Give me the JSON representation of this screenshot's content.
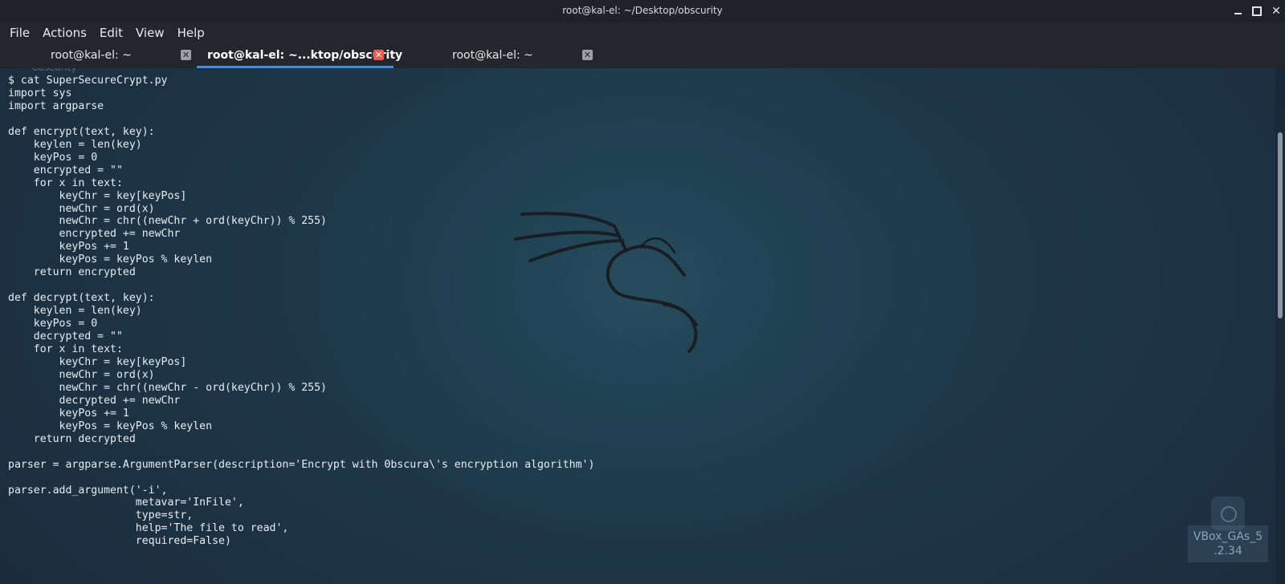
{
  "window": {
    "title": "root@kal-el: ~/Desktop/obscurity",
    "controls": {
      "minimize_icon": "minimize-icon",
      "maximize_icon": "maximize-icon",
      "close_glyph": "✕"
    }
  },
  "menu": {
    "items": [
      "File",
      "Actions",
      "Edit",
      "View",
      "Help"
    ]
  },
  "tabs": [
    {
      "label": "root@kal-el: ~",
      "active": false,
      "close_glyph": "✕"
    },
    {
      "label": "root@kal-el: ~...ktop/obscurity",
      "active": true,
      "close_glyph": "✕"
    },
    {
      "label": "root@kal-el: ~",
      "active": false,
      "close_glyph": "✕"
    }
  ],
  "terminal": {
    "ghost_label": "obscurity",
    "lines": [
      "$ cat SuperSecureCrypt.py",
      "import sys",
      "import argparse",
      "",
      "def encrypt(text, key):",
      "    keylen = len(key)",
      "    keyPos = 0",
      "    encrypted = \"\"",
      "    for x in text:",
      "        keyChr = key[keyPos]",
      "        newChr = ord(x)",
      "        newChr = chr((newChr + ord(keyChr)) % 255)",
      "        encrypted += newChr",
      "        keyPos += 1",
      "        keyPos = keyPos % keylen",
      "    return encrypted",
      "",
      "def decrypt(text, key):",
      "    keylen = len(key)",
      "    keyPos = 0",
      "    decrypted = \"\"",
      "    for x in text:",
      "        keyChr = key[keyPos]",
      "        newChr = ord(x)",
      "        newChr = chr((newChr - ord(keyChr)) % 255)",
      "        decrypted += newChr",
      "        keyPos += 1",
      "        keyPos = keyPos % keylen",
      "    return decrypted",
      "",
      "parser = argparse.ArgumentParser(description='Encrypt with 0bscura\\'s encryption algorithm')",
      "",
      "parser.add_argument('-i',",
      "                    metavar='InFile',",
      "                    type=str,",
      "                    help='The file to read',",
      "                    required=False)"
    ],
    "background_logo": "kali-dragon-icon"
  },
  "desktop_icon": {
    "label_line1": "VBox_GAs_5",
    "label_line2": ".2.34",
    "icon": "disc-icon"
  },
  "colors": {
    "active_tab_underline": "#3a8fe6",
    "active_tab_close": "#ee5a4d",
    "terminal_text": "#e9ecef"
  }
}
